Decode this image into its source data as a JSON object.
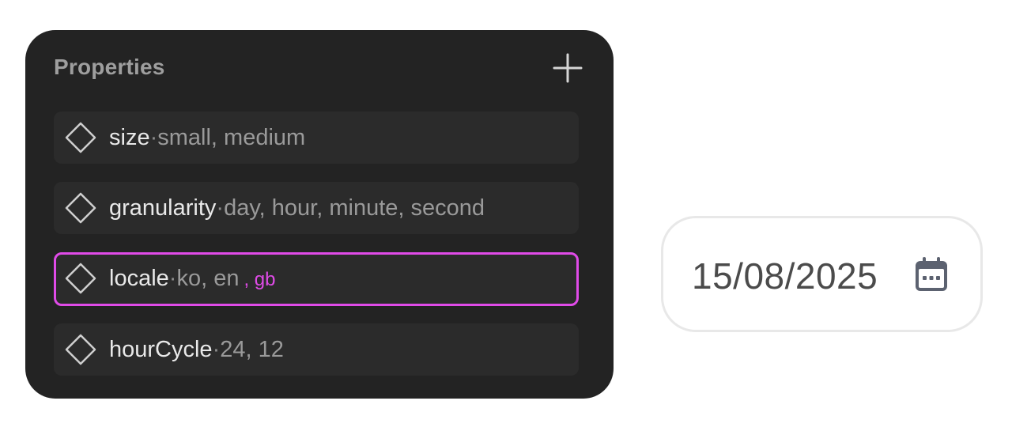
{
  "panel": {
    "title": "Properties",
    "add_icon": "plus-icon",
    "item_icon": "diamond-icon",
    "separator": "·",
    "items": [
      {
        "name": "size",
        "values": "small, medium",
        "extra": ""
      },
      {
        "name": "granularity",
        "values": "day, hour, minute, second",
        "extra": ""
      },
      {
        "name": "locale",
        "values": "ko, en",
        "extra": ", gb",
        "selected": true
      },
      {
        "name": "hourCycle",
        "values": "24, 12",
        "extra": ""
      }
    ]
  },
  "date_field": {
    "value": "15/08/2025",
    "icon": "calendar-icon"
  },
  "colors": {
    "panel_bg": "#232323",
    "row_bg": "#2b2b2b",
    "accent": "#e04be8"
  }
}
